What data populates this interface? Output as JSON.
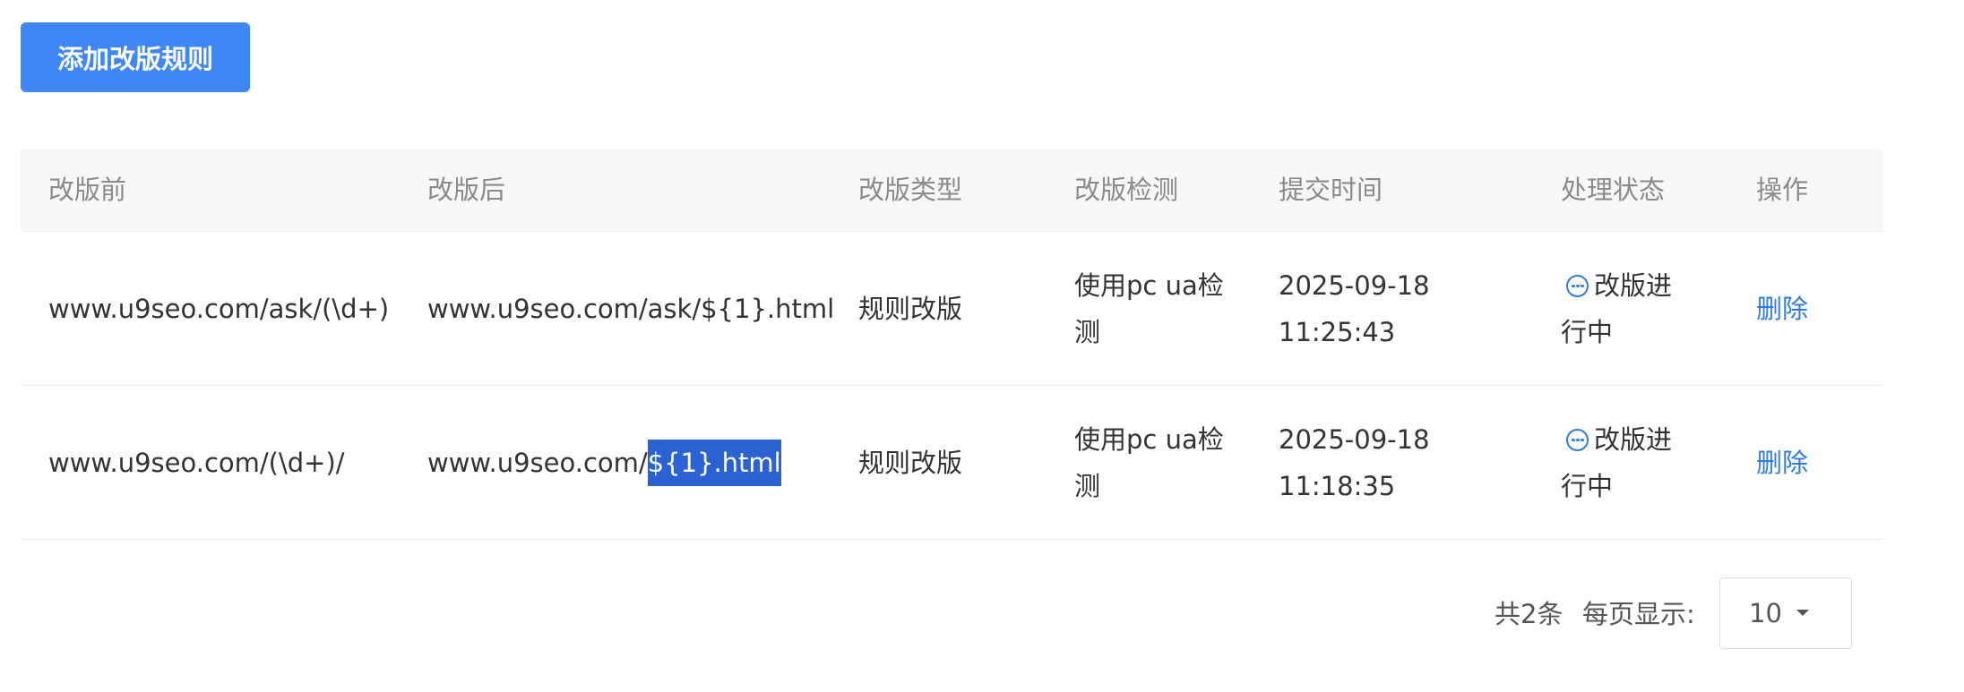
{
  "toolbar": {
    "add_label": "添加改版规则"
  },
  "table": {
    "headers": [
      "改版前",
      "改版后",
      "改版类型",
      "改版检测",
      "提交时间",
      "处理状态",
      "操作"
    ],
    "rows": [
      {
        "before": "www.u9seo.com/ask/(\\d+)",
        "after": "www.u9seo.com/ask/${1}.html",
        "type": "规则改版",
        "check": "使用pc ua检测",
        "date": "2025-09-18",
        "time": "11:25:43",
        "status": "改版进行中",
        "action": "删除"
      },
      {
        "before": "www.u9seo.com/(\\d+)/",
        "after_prefix": "www.u9seo.com/",
        "after_selected": "${1}.html",
        "type": "规则改版",
        "check": "使用pc ua检测",
        "date": "2025-09-18",
        "time": "11:18:35",
        "status": "改版进行中",
        "action": "删除"
      }
    ]
  },
  "pagination": {
    "total": "共2条",
    "per_page_label": "每页显示:",
    "per_page_value": "10"
  },
  "colors": {
    "primary": "#3f86f7",
    "link": "#2f7de1",
    "selection": "#2a62d4",
    "header_bg": "#f7f7f7"
  },
  "icons": {
    "status": "more-circle-icon",
    "dropdown": "caret-down-icon"
  }
}
